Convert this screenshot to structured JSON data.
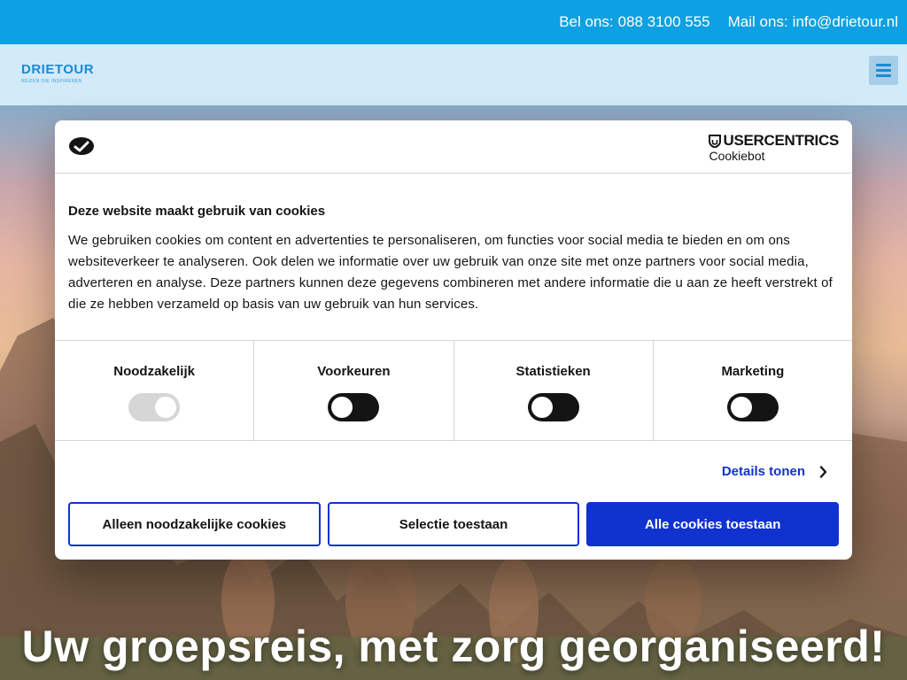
{
  "topbar": {
    "phone_label": "Bel ons:",
    "phone": "088 3100 555",
    "mail_label": "Mail ons:",
    "mail": "info@drietour.nl",
    "color": "#0da0e2"
  },
  "header": {
    "logo_name": "DRIETOUR",
    "logo_tagline": "REIZEN DIE INSPIREREN",
    "menu_icon": "hamburger-icon"
  },
  "hero": {
    "title": "Uw groepsreis, met zorg georganiseerd!"
  },
  "cookie_dialog": {
    "brand_name": "USERCENTRICS",
    "brand_sub": "Cookiebot",
    "title": "Deze website maakt gebruik van cookies",
    "text": "We gebruiken cookies om content en advertenties te personaliseren, om functies voor social media te bieden en om ons websiteverkeer te analyseren. Ook delen we informatie over uw gebruik van onze site met onze partners voor social media, adverteren en analyse. Deze partners kunnen deze gegevens combineren met andere informatie die u aan ze heeft verstrekt of die ze hebben verzameld op basis van uw gebruik van hun services.",
    "categories": [
      {
        "label": "Noodzakelijk",
        "checked": true,
        "disabled": true
      },
      {
        "label": "Voorkeuren",
        "checked": false,
        "disabled": false
      },
      {
        "label": "Statistieken",
        "checked": false,
        "disabled": false
      },
      {
        "label": "Marketing",
        "checked": false,
        "disabled": false
      }
    ],
    "details_label": "Details tonen",
    "buttons": {
      "necessary": "Alleen noodzakelijke cookies",
      "selection": "Selectie toestaan",
      "all": "Alle cookies toestaan"
    },
    "accent_color": "#1032cf"
  }
}
